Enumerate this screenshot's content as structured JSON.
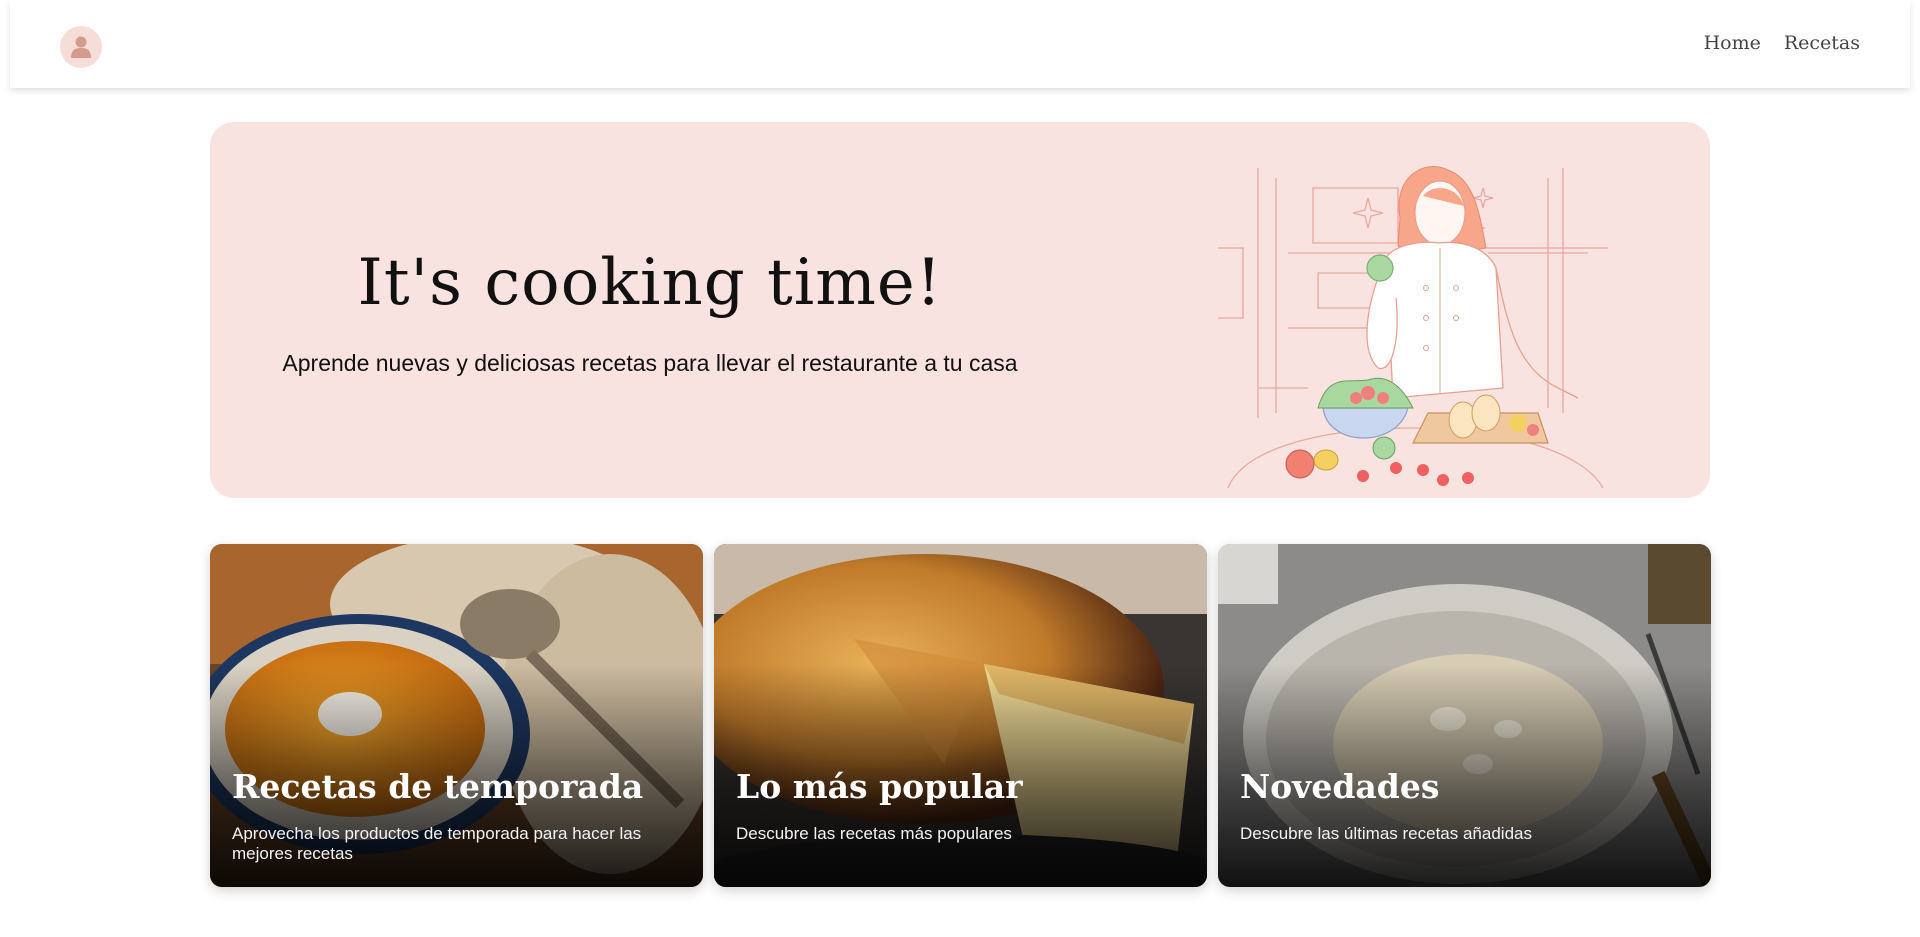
{
  "navbar": {
    "avatar_icon": "user-icon",
    "links": [
      {
        "label": "Home"
      },
      {
        "label": "Recetas"
      }
    ]
  },
  "hero": {
    "title": "It's cooking time!",
    "subtitle": "Aprende nuevas y deliciosas recetas para llevar el restaurante a tu casa",
    "background": "#f9e3e0",
    "illustration": "chef-woman-cooking-illustration"
  },
  "cards": [
    {
      "title": "Recetas de temporada",
      "description": "Aprovecha los productos de temporada para hacer las mejores recetas",
      "image": "pumpkin-soup-photo"
    },
    {
      "title": "Lo más popular",
      "description": "Descubre las recetas más populares",
      "image": "cheesecake-photo"
    },
    {
      "title": "Novedades",
      "description": "Descubre las últimas recetas añadidas",
      "image": "risotto-photo"
    }
  ],
  "colors": {
    "accent": "#f9e3e0",
    "avatar_bg": "#f7ddd8",
    "avatar_icon": "#d49a8e",
    "illustration_line": "#e8a090"
  }
}
